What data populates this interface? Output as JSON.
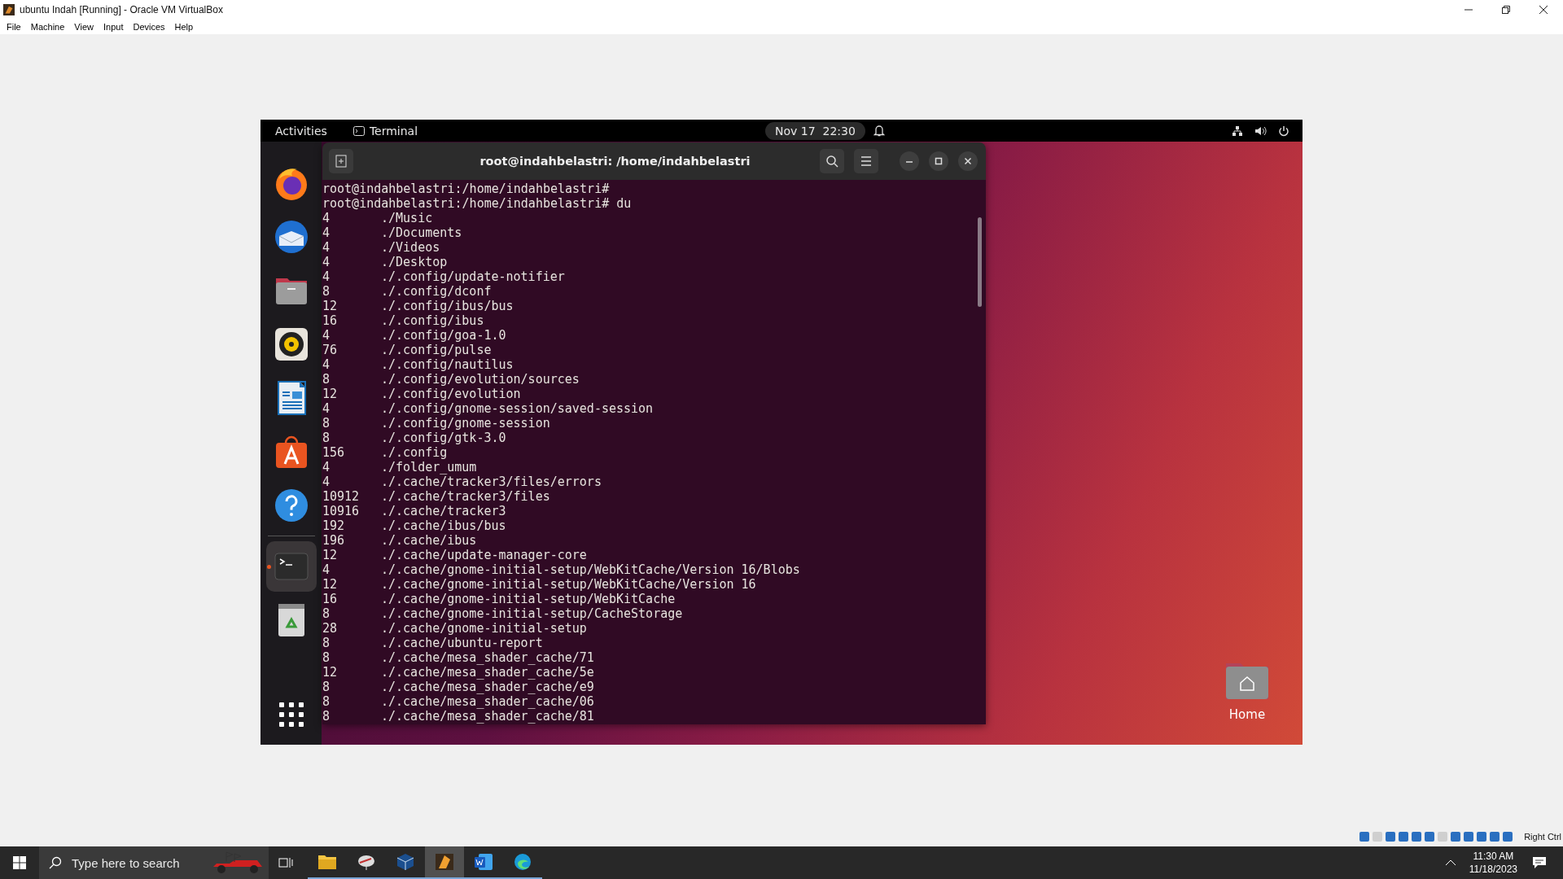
{
  "window": {
    "title": "ubuntu Indah [Running] - Oracle VM VirtualBox"
  },
  "menu": [
    "File",
    "Machine",
    "View",
    "Input",
    "Devices",
    "Help"
  ],
  "vm": {
    "top_bar": {
      "activities": "Activities",
      "app": "Terminal",
      "clock": "Nov 17  22:30"
    },
    "dock": [
      {
        "kind": "firefox",
        "running": false
      },
      {
        "kind": "thunderbird",
        "running": false
      },
      {
        "kind": "files",
        "running": false
      },
      {
        "kind": "rhythmbox",
        "running": false
      },
      {
        "kind": "writer",
        "running": false
      },
      {
        "kind": "software",
        "running": false
      },
      {
        "kind": "help",
        "running": false
      },
      {
        "kind": "terminal",
        "running": true
      },
      {
        "kind": "trash",
        "running": false
      }
    ],
    "terminal": {
      "title": "root@indahbelastri: /home/indahbelastri",
      "lines": [
        {
          "kind": "prompt",
          "text": "root@indahbelastri:/home/indahbelastri#"
        },
        {
          "kind": "prompt",
          "text": "root@indahbelastri:/home/indahbelastri# du"
        },
        {
          "kind": "du",
          "size": "4",
          "path": "./Music"
        },
        {
          "kind": "du",
          "size": "4",
          "path": "./Documents"
        },
        {
          "kind": "du",
          "size": "4",
          "path": "./Videos"
        },
        {
          "kind": "du",
          "size": "4",
          "path": "./Desktop"
        },
        {
          "kind": "du",
          "size": "4",
          "path": "./.config/update-notifier"
        },
        {
          "kind": "du",
          "size": "8",
          "path": "./.config/dconf"
        },
        {
          "kind": "du",
          "size": "12",
          "path": "./.config/ibus/bus"
        },
        {
          "kind": "du",
          "size": "16",
          "path": "./.config/ibus"
        },
        {
          "kind": "du",
          "size": "4",
          "path": "./.config/goa-1.0"
        },
        {
          "kind": "du",
          "size": "76",
          "path": "./.config/pulse"
        },
        {
          "kind": "du",
          "size": "4",
          "path": "./.config/nautilus"
        },
        {
          "kind": "du",
          "size": "8",
          "path": "./.config/evolution/sources"
        },
        {
          "kind": "du",
          "size": "12",
          "path": "./.config/evolution"
        },
        {
          "kind": "du",
          "size": "4",
          "path": "./.config/gnome-session/saved-session"
        },
        {
          "kind": "du",
          "size": "8",
          "path": "./.config/gnome-session"
        },
        {
          "kind": "du",
          "size": "8",
          "path": "./.config/gtk-3.0"
        },
        {
          "kind": "du",
          "size": "156",
          "path": "./.config"
        },
        {
          "kind": "du",
          "size": "4",
          "path": "./folder_umum"
        },
        {
          "kind": "du",
          "size": "4",
          "path": "./.cache/tracker3/files/errors"
        },
        {
          "kind": "du",
          "size": "10912",
          "path": "./.cache/tracker3/files"
        },
        {
          "kind": "du",
          "size": "10916",
          "path": "./.cache/tracker3"
        },
        {
          "kind": "du",
          "size": "192",
          "path": "./.cache/ibus/bus"
        },
        {
          "kind": "du",
          "size": "196",
          "path": "./.cache/ibus"
        },
        {
          "kind": "du",
          "size": "12",
          "path": "./.cache/update-manager-core"
        },
        {
          "kind": "du",
          "size": "4",
          "path": "./.cache/gnome-initial-setup/WebKitCache/Version 16/Blobs"
        },
        {
          "kind": "du",
          "size": "12",
          "path": "./.cache/gnome-initial-setup/WebKitCache/Version 16"
        },
        {
          "kind": "du",
          "size": "16",
          "path": "./.cache/gnome-initial-setup/WebKitCache"
        },
        {
          "kind": "du",
          "size": "8",
          "path": "./.cache/gnome-initial-setup/CacheStorage"
        },
        {
          "kind": "du",
          "size": "28",
          "path": "./.cache/gnome-initial-setup"
        },
        {
          "kind": "du",
          "size": "8",
          "path": "./.cache/ubuntu-report"
        },
        {
          "kind": "du",
          "size": "8",
          "path": "./.cache/mesa_shader_cache/71"
        },
        {
          "kind": "du",
          "size": "12",
          "path": "./.cache/mesa_shader_cache/5e"
        },
        {
          "kind": "du",
          "size": "8",
          "path": "./.cache/mesa_shader_cache/e9"
        },
        {
          "kind": "du",
          "size": "8",
          "path": "./.cache/mesa_shader_cache/06"
        },
        {
          "kind": "du",
          "size": "8",
          "path": "./.cache/mesa_shader_cache/81"
        }
      ]
    },
    "desktop_icons": [
      {
        "label": "Home"
      }
    ]
  },
  "vbox_status": {
    "host_key": "Right Ctrl"
  },
  "taskbar": {
    "search_placeholder": "Type here to search",
    "apps": [
      {
        "kind": "explorer",
        "active": false
      },
      {
        "kind": "app",
        "active": false
      },
      {
        "kind": "virtualbox",
        "active": false
      },
      {
        "kind": "vm",
        "active": true
      },
      {
        "kind": "word",
        "active": false
      },
      {
        "kind": "edge",
        "active": false
      }
    ],
    "time": "11:30 AM",
    "date": "11/18/2023"
  }
}
